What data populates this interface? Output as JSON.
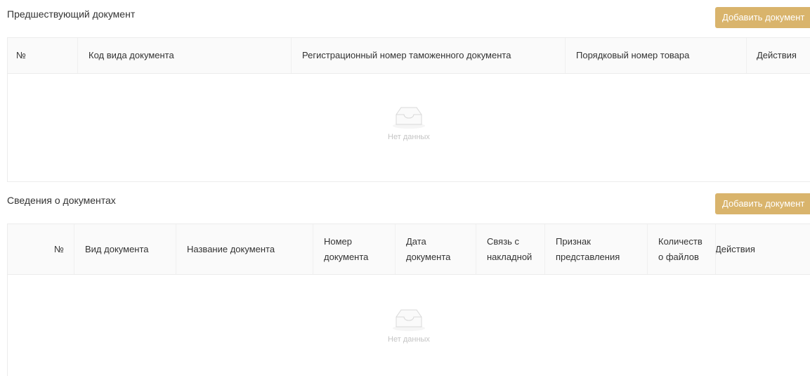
{
  "section1": {
    "title": "Предшествующий документ",
    "add_button": "Добавить документ",
    "columns": [
      "№",
      "Код вида документа",
      "Регистрационный номер таможенного документа",
      "Порядковый номер товара",
      "Действия"
    ],
    "empty_text": "Нет данных"
  },
  "section2": {
    "title": "Сведения о документах",
    "add_button": "Добавить документ",
    "columns": [
      "№",
      "Вид документа",
      "Название документа",
      "Номер документа",
      "Дата документа",
      "Связь с накладной",
      "Признак представления",
      "Количеств о файлов",
      "Действия"
    ],
    "empty_text": "Нет данных"
  },
  "colors": {
    "accent": "#d9b46c",
    "header_bg": "#fafafa",
    "border": "#ececec",
    "empty_text": "#c4c4c4"
  },
  "icons": {
    "empty": "inbox-icon"
  }
}
